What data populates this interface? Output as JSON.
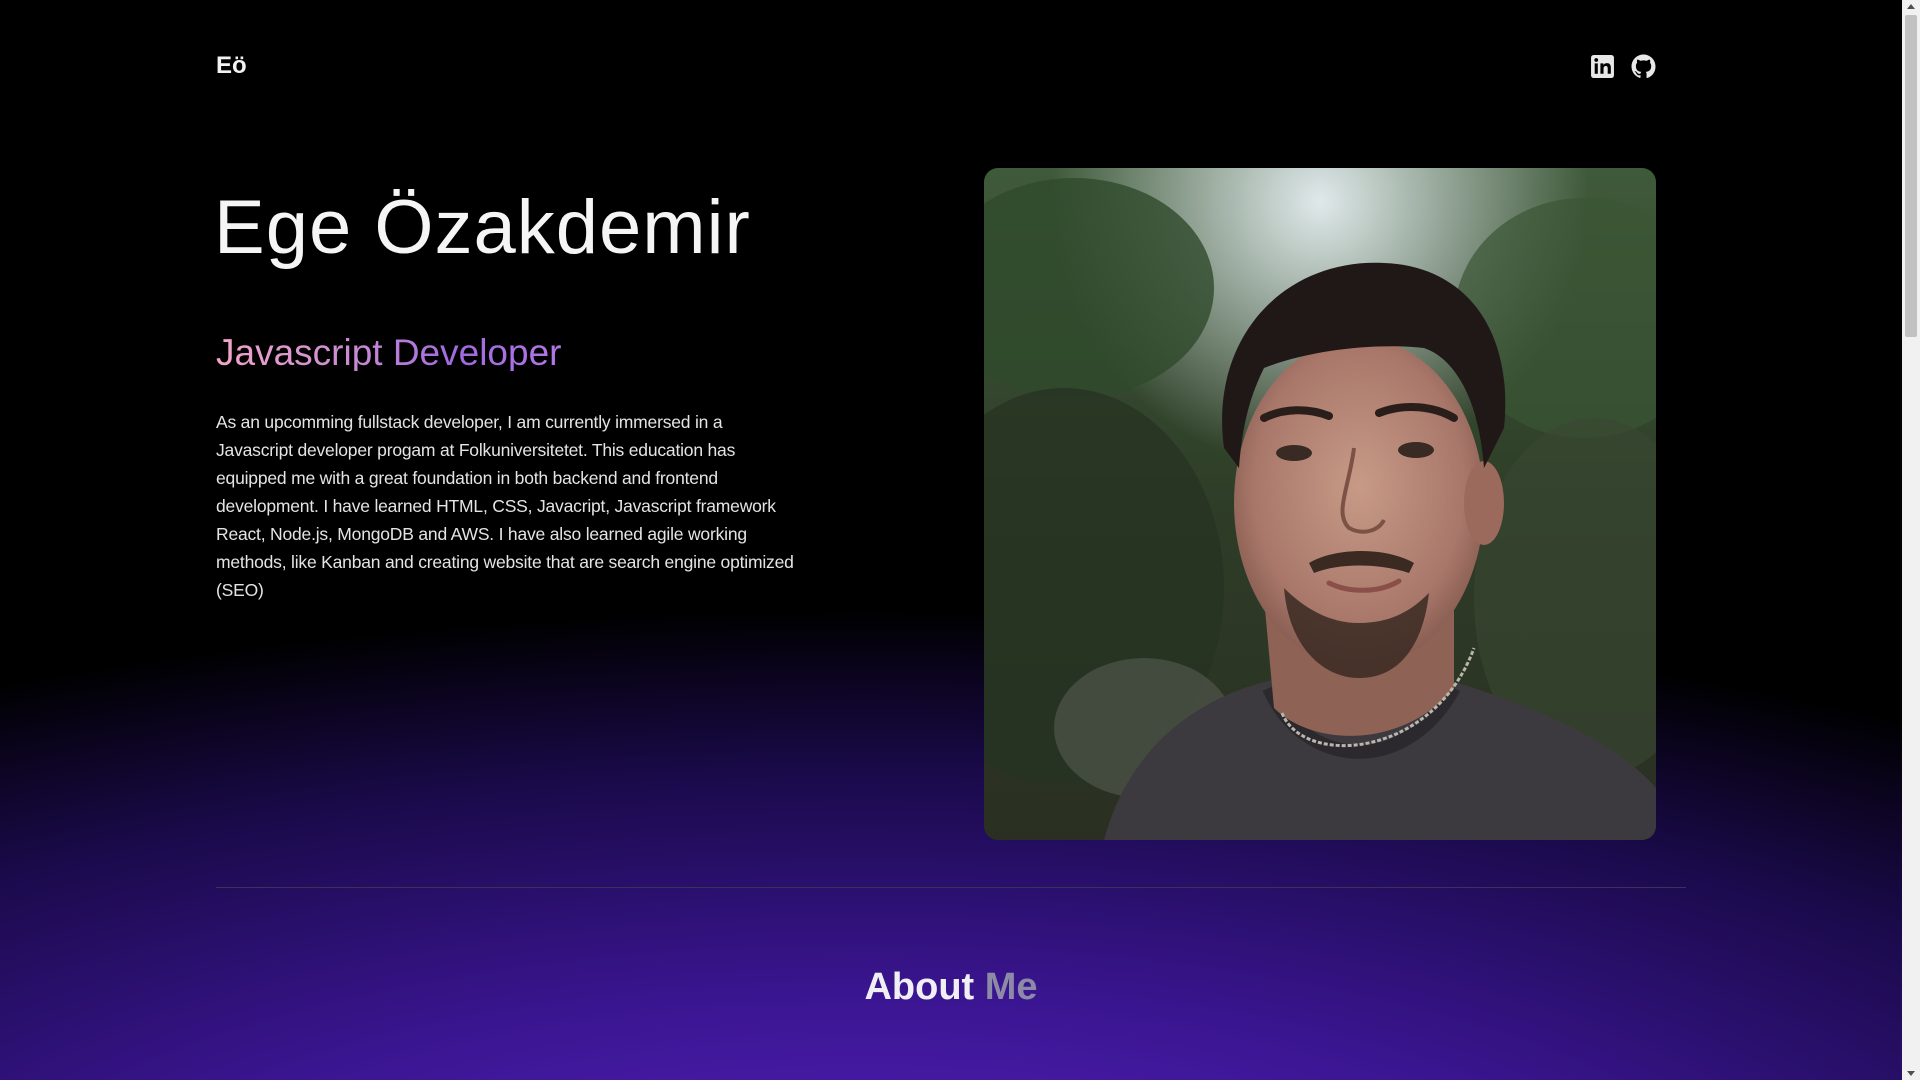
{
  "header": {
    "logo": "Eö",
    "social": [
      {
        "name": "linkedin-icon"
      },
      {
        "name": "github-icon"
      }
    ]
  },
  "hero": {
    "name": "Ege Özakdemir",
    "role": "Javascript Developer",
    "bio": "As an upcomming fullstack developer, I am currently immersed in a Javascript developer progam at Folkuniversitetet. This education has equipped me with a great foundation in both backend and frontend development. I have learned HTML, CSS, Javacript, Javascript framework React, Node.js, MongoDB and AWS. I have also learned agile working methods, like Kanban and creating website that are search engine optimized (SEO)"
  },
  "about": {
    "title_part1": "About",
    "title_part2": "Me"
  },
  "colors": {
    "background_top": "#000000",
    "background_bottom": "#4a1fb8",
    "role_gradient_start": "#f3a6c8",
    "role_gradient_end": "#a06ae0"
  }
}
